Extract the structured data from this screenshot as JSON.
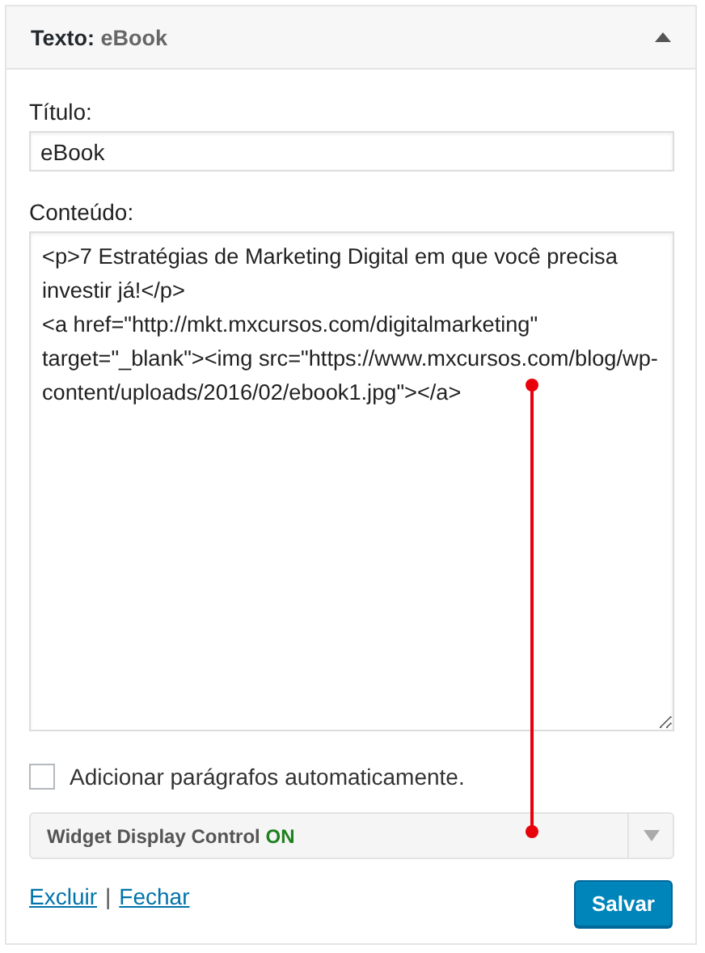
{
  "widget": {
    "label": "Texto:",
    "title": "eBook",
    "expanded": true
  },
  "title_field": {
    "label": "Título:",
    "value": "eBook"
  },
  "content_field": {
    "label": "Conteúdo:",
    "value": "<p>7 Estratégias de Marketing Digital em que você precisa investir já!</p>\n<a href=\"http://mkt.mxcursos.com/digitalmarketing\" target=\"_blank\"><img src=\"https://www.mxcursos.com/blog/wp-content/uploads/2016/02/ebook1.jpg\"></a>"
  },
  "auto_paragraphs": {
    "label": "Adicionar parágrafos automaticamente.",
    "checked": false
  },
  "display_control": {
    "label": "Widget Display Control",
    "status": "ON",
    "on": true,
    "expanded": false
  },
  "links": [
    "Excluir",
    "Fechar"
  ],
  "separator": "|",
  "save_button": "Salvar"
}
